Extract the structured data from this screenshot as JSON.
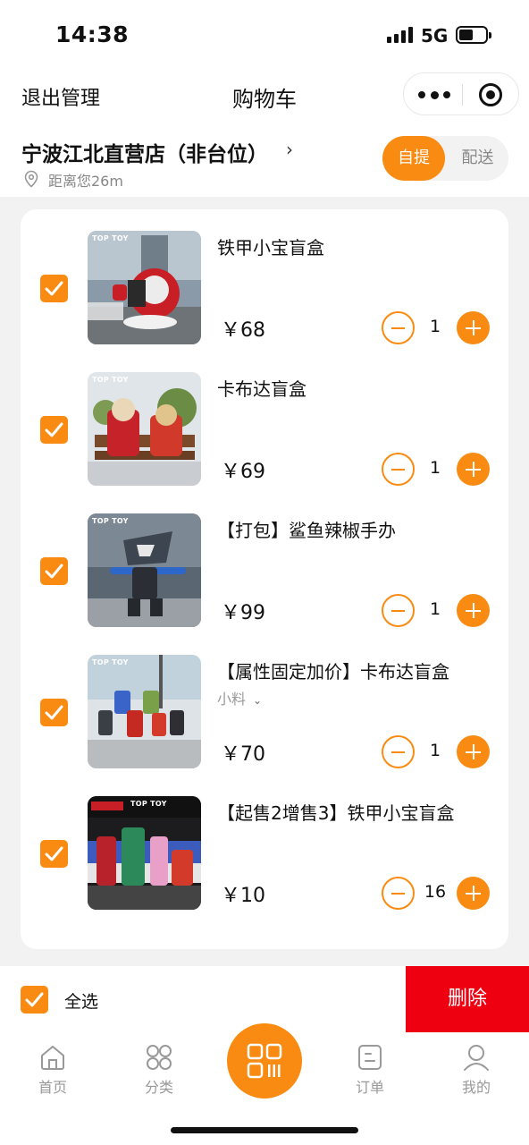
{
  "status_bar": {
    "time": "14:38",
    "network": "5G"
  },
  "nav": {
    "exit_label": "退出管理",
    "title": "购物车",
    "more_icon": "more-dots-icon",
    "close_icon": "target-circle-icon"
  },
  "store": {
    "name": "宁波江北直营店（非台位）",
    "chevron": "›",
    "distance": "距离您26m",
    "modes": [
      "自提",
      "配送"
    ],
    "selected_mode": "自提"
  },
  "cart": {
    "brand_tag": "TOP TOY",
    "items": [
      {
        "name": "铁甲小宝盲盒",
        "spec": "",
        "price": "￥68",
        "qty": "1",
        "checked": true
      },
      {
        "name": "卡布达盲盒",
        "spec": "",
        "price": "￥69",
        "qty": "1",
        "checked": true
      },
      {
        "name": "【打包】鲨鱼辣椒手办",
        "spec": "",
        "price": "￥99",
        "qty": "1",
        "checked": true
      },
      {
        "name": "【属性固定加价】卡布达盲盒",
        "spec": "小料",
        "price": "￥70",
        "qty": "1",
        "checked": true
      },
      {
        "name": "【起售2增售3】铁甲小宝盲盒",
        "spec": "",
        "price": "￥10",
        "qty": "16",
        "checked": true
      }
    ]
  },
  "actions": {
    "select_all_label": "全选",
    "delete_label": "删除"
  },
  "tabbar": [
    {
      "label": "首页",
      "icon": "home-icon"
    },
    {
      "label": "分类",
      "icon": "category-icon"
    },
    {
      "label": "",
      "icon": "qr-scan-icon"
    },
    {
      "label": "订单",
      "icon": "order-icon"
    },
    {
      "label": "我的",
      "icon": "profile-icon"
    }
  ],
  "colors": {
    "accent": "#f98b12",
    "danger": "#ee0011"
  }
}
